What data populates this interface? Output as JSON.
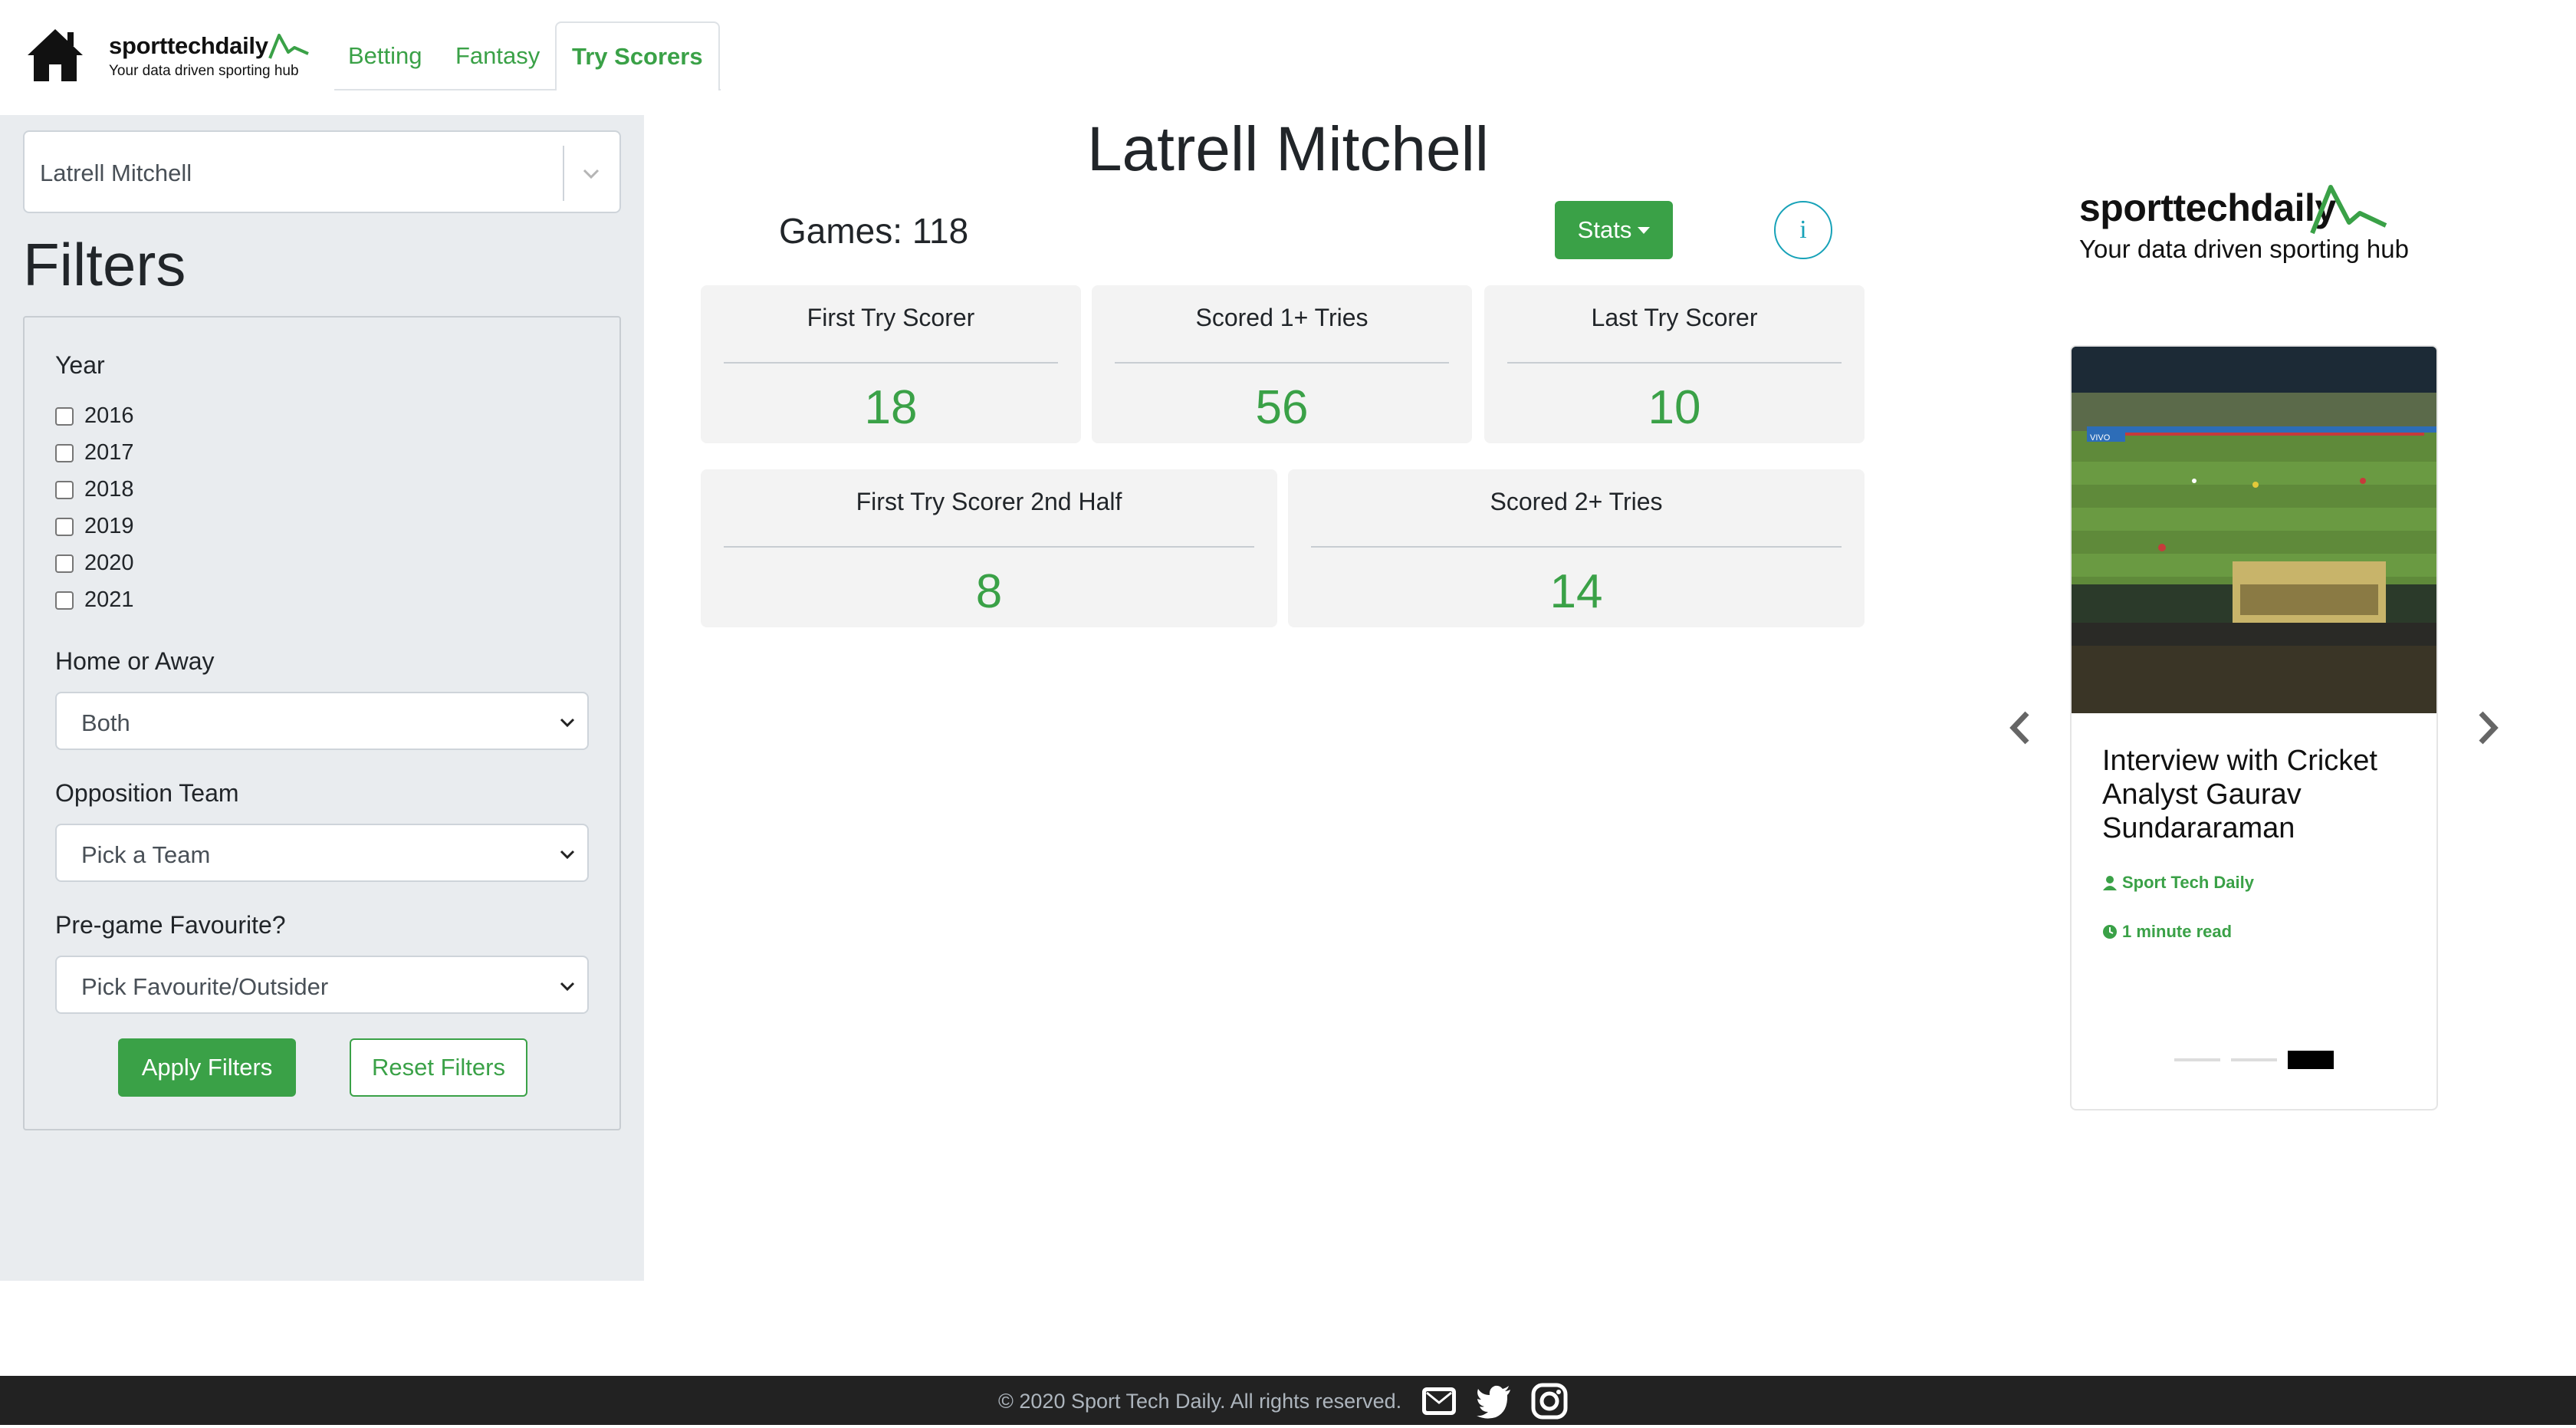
{
  "brand": {
    "name": "sporttechdaily",
    "tagline": "Your data driven sporting hub"
  },
  "nav": {
    "tabs": [
      {
        "label": "Betting"
      },
      {
        "label": "Fantasy"
      },
      {
        "label": "Try Scorers"
      }
    ],
    "active_tab": "Try Scorers"
  },
  "sidebar": {
    "player_select": {
      "value": "Latrell Mitchell"
    },
    "filters_title": "Filters",
    "year": {
      "label": "Year",
      "options": [
        "2016",
        "2017",
        "2018",
        "2019",
        "2020",
        "2021"
      ]
    },
    "home_away": {
      "label": "Home or Away",
      "value": "Both"
    },
    "opposition": {
      "label": "Opposition Team",
      "value": "Pick a Team"
    },
    "favourite": {
      "label": "Pre-game Favourite?",
      "value": "Pick Favourite/Outsider"
    },
    "apply_label": "Apply Filters",
    "reset_label": "Reset Filters"
  },
  "main": {
    "player_name": "Latrell Mitchell",
    "games": "Games: 118",
    "stats_label": "Stats",
    "info_label": "i",
    "cards": [
      {
        "title": "First Try Scorer",
        "value": "18"
      },
      {
        "title": "Scored 1+ Tries",
        "value": "56"
      },
      {
        "title": "Last Try Scorer",
        "value": "10"
      },
      {
        "title": "First Try Scorer 2nd Half",
        "value": "8"
      },
      {
        "title": "Scored 2+ Tries",
        "value": "14"
      }
    ]
  },
  "carousel": {
    "title": "Interview with Cricket Analyst Gaurav Sundararaman",
    "author": "Sport Tech Daily",
    "read_time": "1 minute read",
    "slide_count": 3,
    "active_slide": 3,
    "image_banner": "VIVO"
  },
  "footer": {
    "copyright": "© 2020 Sport Tech Daily. All rights reserved."
  },
  "colors": {
    "accent": "#3aa147",
    "sidebar_bg": "#e9ecef",
    "card_bg": "#f3f3f3",
    "footer_bg": "#222222",
    "info": "#17a2b8"
  }
}
